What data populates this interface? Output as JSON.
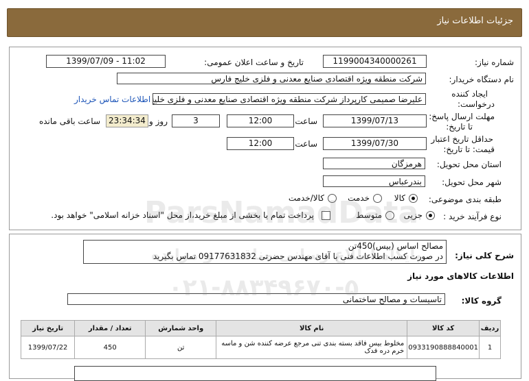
{
  "header": {
    "title": "جزئیات اطلاعات نیاز"
  },
  "form": {
    "need_number_label": "شماره نیاز:",
    "need_number": "1199004340000261",
    "announce_label": "تاریخ و ساعت اعلان عمومی:",
    "announce_value": "1399/07/09 - 11:02",
    "buyer_label": "نام دستگاه خریدار:",
    "buyer_value": "شرکت منطقه ویژه اقتصادی صنایع معدنی و فلزی خلیج فارس",
    "creator_label_1": "ایجاد کننده",
    "creator_label_2": "درخواست:",
    "creator_value": "علیرضا صمیمی کارپرداز شرکت منطقه ویژه اقتصادی صنایع معدنی و فلزی خلیج فارس",
    "contact_link": "اطلاعات تماس خریدار",
    "send_deadline_label_1": "مهلت ارسال پاسخ:",
    "send_deadline_label_2": "تا تاریخ:",
    "send_date": "1399/07/13",
    "time_label": "ساعت",
    "send_time": "12:00",
    "days_value": "3",
    "days_label": "روز و",
    "remaining_time": "23:34:34",
    "remaining_label": "ساعت باقی مانده",
    "validity_label_1": "حداقل تاریخ اعتبار",
    "validity_label_2": "قیمت: تا تاریخ:",
    "validity_date": "1399/07/30",
    "validity_time": "12:00",
    "province_label": "استان محل تحویل:",
    "province_value": "هرمزگان",
    "city_label": "شهر محل تحویل:",
    "city_value": "بندرعباس",
    "category_label": "طبقه بندی موضوعی:",
    "category_options": [
      "کالا",
      "خدمت",
      "کالا/خدمت"
    ],
    "process_label": "نوع فرآیند خرید :",
    "process_options": [
      "جزیی",
      "متوسط"
    ],
    "payment_note": "پرداخت تمام یا بخشی از مبلغ خرید،از محل \"اسناد خزانه اسلامی\" خواهد بود."
  },
  "description": {
    "label": "شرح کلی نیاز:",
    "line1": "مصالح اساس (بیس)450تن",
    "line2": "در صورت کسب اطلاعات فنی با آقای مهندس حضرتی 09177631832 تماس بگیرید"
  },
  "goods": {
    "section_title": "اطلاعات کالاهای مورد نیاز",
    "group_label": "گروه کالا:",
    "group_value": "تاسیسات و مصالح ساختمانی",
    "columns": [
      "ردیف",
      "کد کالا",
      "نام کالا",
      "واحد شمارش",
      "تعداد / مقدار",
      "تاریخ نیاز"
    ],
    "rows": [
      [
        "1",
        "0933190888840001",
        "مخلوط بیس فاقد بسته بندی تنی مرجع عرضه کننده شن و ماسه خرم دره فدک",
        "تن",
        "450",
        "1399/07/22"
      ]
    ]
  },
  "watermark": {
    "brand": "ParsNamadData",
    "line1": "پایگاه اطلاع رسانی مناقصه و مزایده",
    "phone": "۰۲۱-۸۸۳۴۹۶۷۰-۵"
  }
}
